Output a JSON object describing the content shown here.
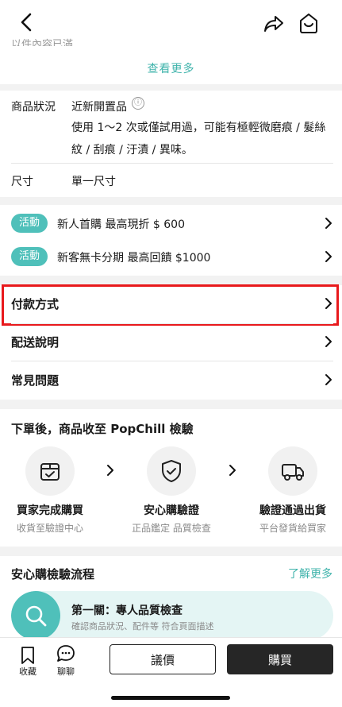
{
  "header": {
    "partial_text": "以件內容已滿",
    "see_more": "查看更多"
  },
  "condition": {
    "label": "商品狀況",
    "title": "近新開置品",
    "info_icon": "ⓘ",
    "description": "使用 1～2 次或僅試用過，可能有極輕微磨痕 / 髮絲紋 / 刮痕 / 汙漬 / 異味。"
  },
  "size": {
    "label": "尺寸",
    "value": "單一尺寸"
  },
  "promos": [
    {
      "tag": "活動",
      "text": "新人首購 最高現折 $ 600"
    },
    {
      "tag": "活動",
      "text": "新客無卡分期 最高回饋 $1000"
    }
  ],
  "rows": {
    "payment": "付款方式",
    "delivery": "配送說明",
    "faq": "常見問題"
  },
  "inspection": {
    "title": "下單後，商品收至 PopChill 檢驗",
    "steps": [
      {
        "title": "買家完成購買",
        "sub": "收貨至驗證中心",
        "icon": "box-icon"
      },
      {
        "title": "安心購驗證",
        "sub": "正品鑑定 品質檢查",
        "icon": "shield-check-icon"
      },
      {
        "title": "驗證通過出貨",
        "sub": "平台發貨給買家",
        "icon": "truck-icon"
      }
    ]
  },
  "flow": {
    "title": "安心購檢驗流程",
    "learn_more": "了解更多",
    "card_title": "第一關：專人品質檢查",
    "card_sub": "確認商品狀況、配件等 符合頁面描述"
  },
  "bottombar": {
    "favorite": "收藏",
    "chat": "聊聊",
    "bargain": "議價",
    "buy": "購買"
  },
  "colors": {
    "accent": "#4fc0ba",
    "highlight": "#e8191c",
    "dark_button": "#262626"
  }
}
